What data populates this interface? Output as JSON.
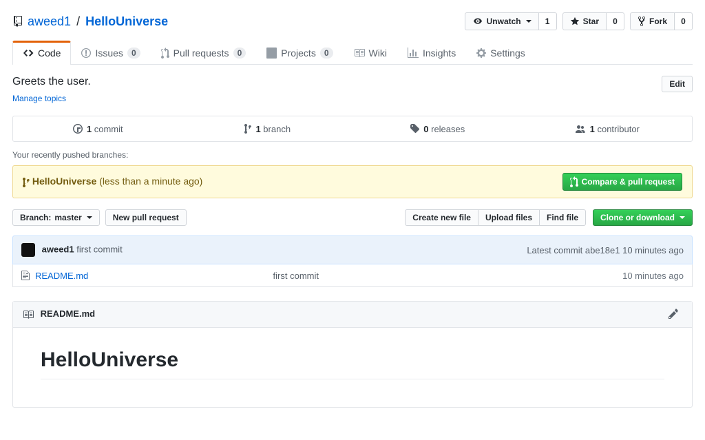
{
  "header": {
    "owner": "aweed1",
    "separator": "/",
    "repo": "HelloUniverse",
    "watch_label": "Unwatch",
    "watch_count": "1",
    "star_label": "Star",
    "star_count": "0",
    "fork_label": "Fork",
    "fork_count": "0"
  },
  "tabs": {
    "code": "Code",
    "issues": "Issues",
    "issues_count": "0",
    "pulls": "Pull requests",
    "pulls_count": "0",
    "projects": "Projects",
    "projects_count": "0",
    "wiki": "Wiki",
    "insights": "Insights",
    "settings": "Settings"
  },
  "repo": {
    "description": "Greets the user.",
    "edit_label": "Edit",
    "manage_topics": "Manage topics"
  },
  "stats": {
    "commits_n": "1",
    "commits_label": "commit",
    "branches_n": "1",
    "branches_label": "branch",
    "releases_n": "0",
    "releases_label": "releases",
    "contributors_n": "1",
    "contributors_label": "contributor"
  },
  "pushed": {
    "heading": "Your recently pushed branches:",
    "branch": "HelloUniverse",
    "when": "(less than a minute ago)",
    "compare_btn": "Compare & pull request"
  },
  "actions": {
    "branch_prefix": "Branch: ",
    "branch_current": "master",
    "new_pr": "New pull request",
    "create_file": "Create new file",
    "upload": "Upload files",
    "find": "Find file",
    "clone": "Clone or download"
  },
  "commit": {
    "author": "aweed1",
    "message": "first commit",
    "latest_prefix": "Latest commit ",
    "sha": "abe18e1",
    "when": " 10 minutes ago"
  },
  "files": [
    {
      "name": "README.md",
      "message": "first commit",
      "time": "10 minutes ago"
    }
  ],
  "readme": {
    "title": "README.md",
    "heading": "HelloUniverse"
  }
}
